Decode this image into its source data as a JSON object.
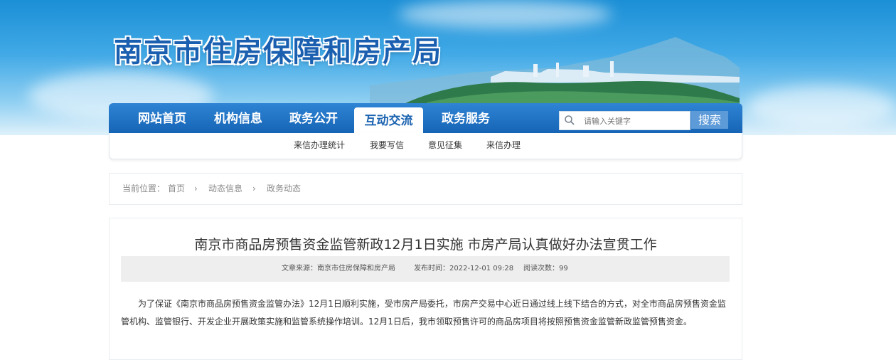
{
  "header": {
    "site_title": "南京市住房保障和房产局"
  },
  "nav": {
    "items": [
      {
        "label": "网站首页"
      },
      {
        "label": "机构信息"
      },
      {
        "label": "政务公开"
      },
      {
        "label": "互动交流",
        "active": true
      },
      {
        "label": "政务服务"
      }
    ]
  },
  "search": {
    "placeholder": "请输入关键字",
    "button_label": "搜索"
  },
  "subnav": {
    "items": [
      {
        "label": "来信办理统计"
      },
      {
        "label": "我要写信"
      },
      {
        "label": "意见征集"
      },
      {
        "label": "来信办理"
      }
    ]
  },
  "breadcrumb": {
    "prefix": "当前位置：",
    "items": [
      "首页",
      "动态信息",
      "政务动态"
    ],
    "separator": "›"
  },
  "article": {
    "title": "南京市商品房预售资金监管新政12月1日实施 市房产局认真做好办法宣贯工作",
    "meta": {
      "source": "文章来源：南京市住房保障和房产局",
      "published": "发布时间：2022-12-01 09:28",
      "reads": "阅读次数：99"
    },
    "body": "为了保证《南京市商品房预售资金监管办法》12月1日顺利实施，受市房产局委托，市房产交易中心近日通过线上线下结合的方式，对全市商品房预售资金监管机构、监管银行、开发企业开展政策实施和监管系统操作培训。12月1日后，我市领取预售许可的商品房项目将按照预售资金监管新政监管预售资金。"
  },
  "colors": {
    "brand_blue": "#1c63b0",
    "nav_gradient_top": "#2f84d4",
    "search_button": "#5d9ad8"
  }
}
